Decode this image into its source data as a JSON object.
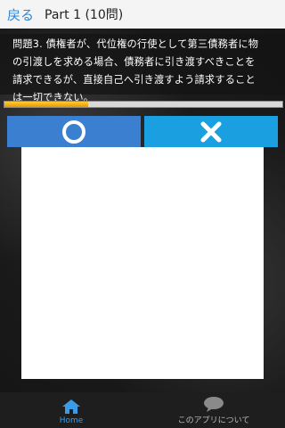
{
  "header": {
    "back_label": "戻る",
    "title": "Part 1 (10問)"
  },
  "question": {
    "lines": [
      "問題3. 債権者が、代位権の行使として第三債務者に物",
      "の引渡しを求める場合、債務者に引き渡すべきことを",
      "請求できるが、直接自己へ引き渡すよう請求すること",
      "は一切できない。"
    ]
  },
  "progress": {
    "fraction": 0.3
  },
  "answers": {
    "true_icon": "circle-icon",
    "false_icon": "cross-icon"
  },
  "tabs": {
    "home_label": "Home",
    "home_icon": "home-icon",
    "about_label": "このアプリについて",
    "about_icon": "speech-bubble-icon"
  },
  "colors": {
    "accent": "#3a7fd0",
    "secondary": "#1aa0e0",
    "progress": "#f2b21a"
  }
}
